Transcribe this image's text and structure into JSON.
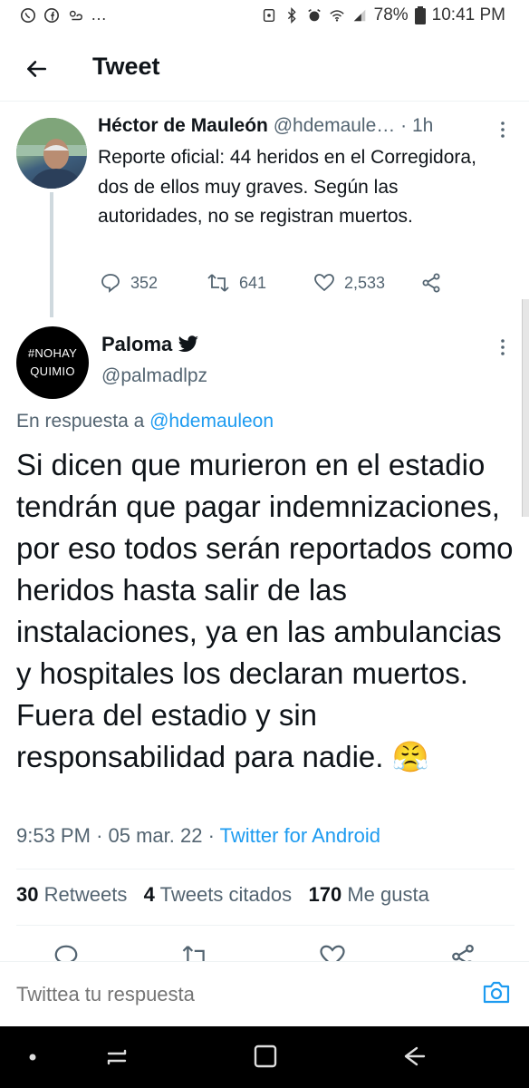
{
  "status_bar": {
    "battery": "78%",
    "time": "10:41 PM"
  },
  "header": {
    "title": "Tweet"
  },
  "parent_tweet": {
    "name": "Héctor de Mauleón",
    "handle": "@hdemaule…",
    "time": "· 1h",
    "text": "Reporte oficial: 44 heridos en el Corregidora, dos de ellos muy graves. Según las autoridades, no se registran muertos.",
    "replies": "352",
    "retweets": "641",
    "likes": "2,533"
  },
  "main_tweet": {
    "name": "Paloma",
    "handle": "@palmadlpz",
    "avatar_line1": "#NOHAY",
    "avatar_line2": "QUIMIO",
    "reply_prefix": "En respuesta a",
    "reply_handle": "@hdemauleon",
    "text": "Si dicen que murieron en el estadio tendrán que pagar indemnizaciones, por eso todos serán reportados como heridos hasta salir de las instalaciones, ya en las ambulancias y hospitales los declaran muertos. Fuera del estadio y sin responsabilidad para nadie.",
    "emoji": "😤",
    "time": "9:53 PM",
    "sep1": "·",
    "date": "05 mar. 22",
    "sep2": "·",
    "source": "Twitter for Android",
    "stats": {
      "retweets_count": "30",
      "retweets_label": "Retweets",
      "quotes_count": "4",
      "quotes_label": "Tweets citados",
      "likes_count": "170",
      "likes_label": "Me gusta"
    }
  },
  "reply_bar": {
    "placeholder": "Twittea tu respuesta"
  },
  "colors": {
    "accent": "#1d9bf0",
    "text": "#0f1419",
    "secondary": "#536471"
  }
}
